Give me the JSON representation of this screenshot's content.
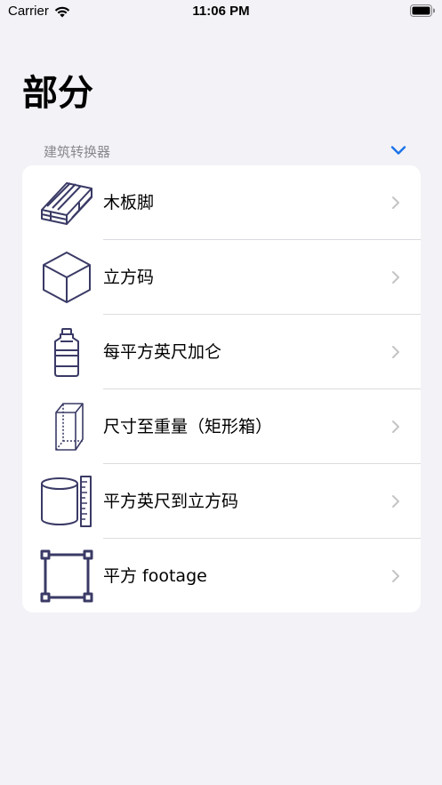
{
  "status_bar": {
    "carrier": "Carrier",
    "time": "11:06 PM"
  },
  "page": {
    "title": "部分"
  },
  "section": {
    "label": "建筑转换器",
    "accent_color": "#1a73e8"
  },
  "items": [
    {
      "label": "木板脚",
      "icon": "lumber-icon"
    },
    {
      "label": "立方码",
      "icon": "cube-icon"
    },
    {
      "label": "每平方英尺加仑",
      "icon": "water-jug-icon"
    },
    {
      "label": "尺寸至重量（矩形箱）",
      "icon": "rectangular-box-icon"
    },
    {
      "label": "平方英尺到立方码",
      "icon": "cylinder-ruler-icon"
    },
    {
      "label": "平方 footage",
      "icon": "square-selection-icon"
    }
  ],
  "icon_color": "#3a3a66"
}
